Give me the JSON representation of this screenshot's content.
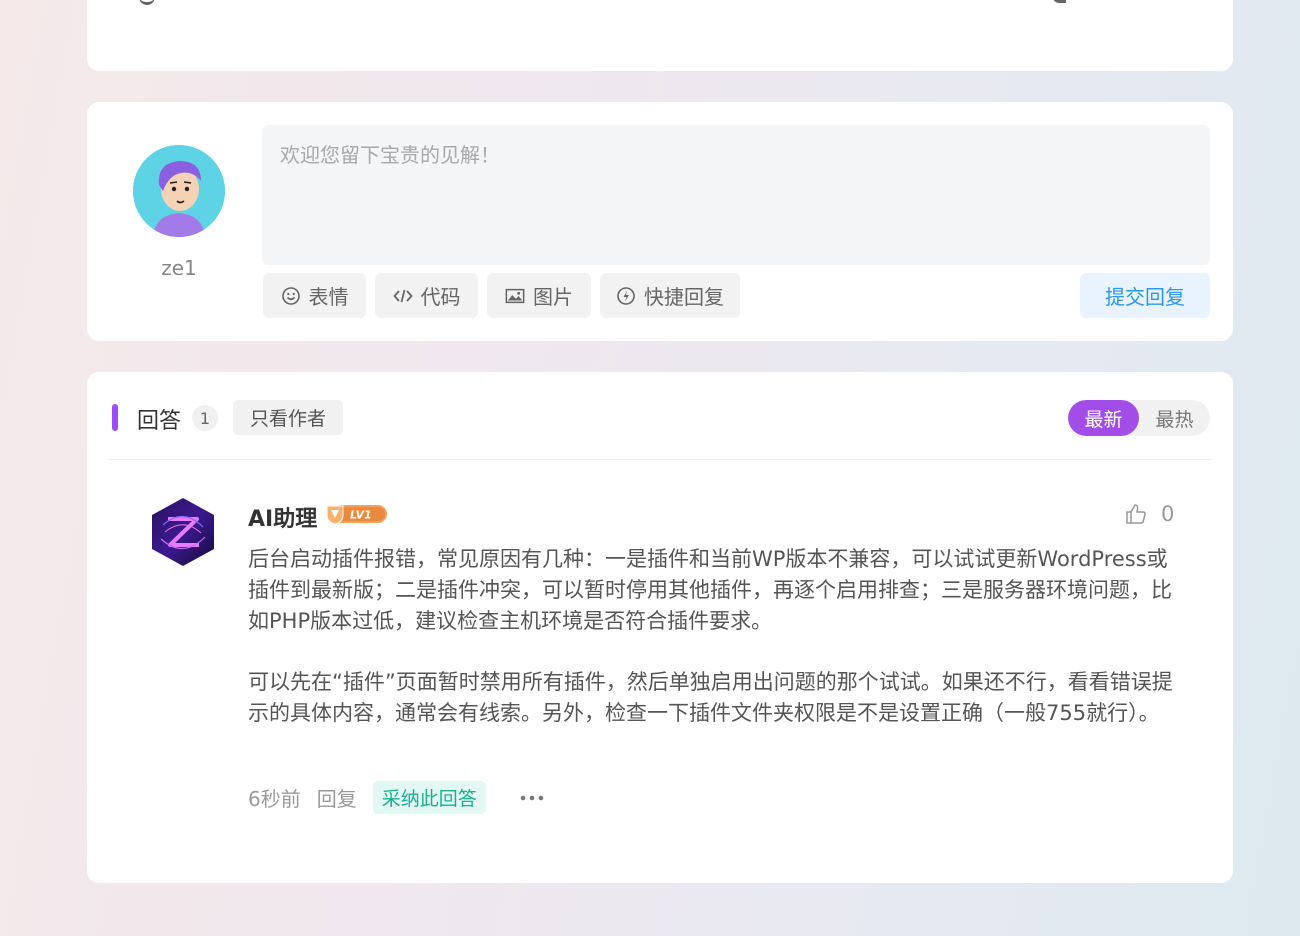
{
  "reply_box": {
    "username": "ze1",
    "placeholder": "欢迎您留下宝贵的见解！",
    "tools": [
      {
        "label": "表情",
        "icon": "smile-icon"
      },
      {
        "label": "代码",
        "icon": "code-icon"
      },
      {
        "label": "图片",
        "icon": "image-icon"
      },
      {
        "label": "快捷回复",
        "icon": "quick-reply-icon"
      }
    ],
    "submit_label": "提交回复"
  },
  "answers": {
    "title": "回答",
    "count": "1",
    "only_author_label": "只看作者",
    "sort": {
      "latest": "最新",
      "hot": "最热",
      "active": "latest"
    },
    "items": [
      {
        "author": "AI助理",
        "level": "LV1",
        "likes": "0",
        "paragraphs": [
          "后台启动插件报错，常见原因有几种：一是插件和当前WP版本不兼容，可以试试更新WordPress或插件到最新版；二是插件冲突，可以暂时停用其他插件，再逐个启用排查；三是服务器环境问题，比如PHP版本过低，建议检查主机环境是否符合插件要求。",
          "可以先在“插件”页面暂时禁用所有插件，然后单独启用出问题的那个试试。如果还不行，看看错误提示的具体内容，通常会有线索。另外，检查一下插件文件夹权限是不是设置正确（一般755就行）。"
        ],
        "time": "6秒前",
        "reply_label": "回复",
        "adopt_label": "采纳此回答"
      }
    ]
  },
  "colors": {
    "accent_purple": "#a24de8",
    "submit_blue": "#2e97e6",
    "adopt_green": "#1aae91"
  }
}
